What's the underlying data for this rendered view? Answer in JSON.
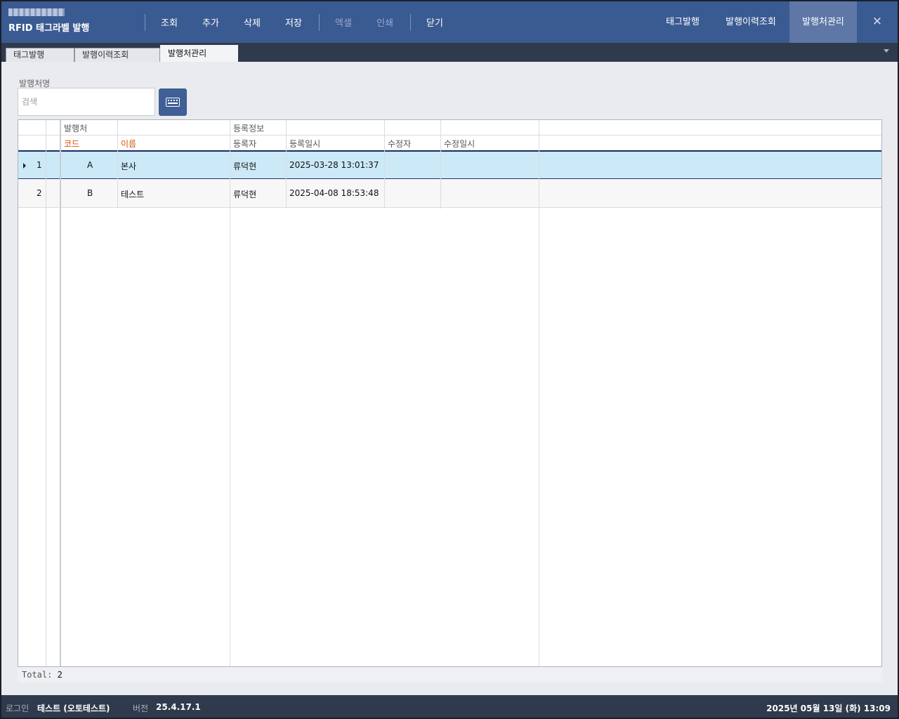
{
  "header": {
    "app_title": "RFID 태그라벨 발행",
    "toolbar": [
      {
        "label": "조회",
        "enabled": true
      },
      {
        "label": "추가",
        "enabled": true
      },
      {
        "label": "삭제",
        "enabled": true
      },
      {
        "label": "저장",
        "enabled": true
      },
      {
        "label": "엑셀",
        "enabled": false
      },
      {
        "label": "인쇄",
        "enabled": false
      },
      {
        "label": "닫기",
        "enabled": true
      }
    ],
    "nav": [
      {
        "label": "태그발행",
        "active": false
      },
      {
        "label": "발행이력조회",
        "active": false
      },
      {
        "label": "발행처관리",
        "active": true
      }
    ],
    "close_glyph": "✕"
  },
  "tabs": [
    {
      "label": "태그발행",
      "active": false
    },
    {
      "label": "발행이력조회",
      "active": false
    },
    {
      "label": "발행처관리",
      "active": true
    }
  ],
  "search": {
    "label": "발행처명",
    "placeholder": "검색",
    "value": "",
    "keyboard_icon": "keyboard-icon"
  },
  "grid": {
    "bands": [
      {
        "label": "발행처"
      },
      {
        "label": "등록정보"
      }
    ],
    "columns": [
      {
        "label": "코드",
        "required": true
      },
      {
        "label": "이름",
        "required": true
      },
      {
        "label": "등록자",
        "required": false
      },
      {
        "label": "등록일시",
        "required": false
      },
      {
        "label": "수정자",
        "required": false
      },
      {
        "label": "수정일시",
        "required": false
      }
    ],
    "rows": [
      {
        "num": "1",
        "code": "A",
        "name": "본사",
        "reg_user": "류덕현",
        "reg_date": "2025-03-28 13:01:37",
        "mod_user": "",
        "mod_date": "",
        "selected": true
      },
      {
        "num": "2",
        "code": "B",
        "name": "테스트",
        "reg_user": "류덕현",
        "reg_date": "2025-04-08 18:53:48",
        "mod_user": "",
        "mod_date": "",
        "selected": false
      }
    ],
    "summary_label": "Total:",
    "summary_value": "2"
  },
  "status": {
    "login_label": "로그인",
    "login_value": "테스트 (오토테스트)",
    "version_label": "버전",
    "version_value": "25.4.17.1",
    "datetime": "2025년 05월 13일 (화) 13:09"
  },
  "colors": {
    "header_bg": "#3a5a92",
    "header_active": "#5e77a6",
    "selected_row": "#cce9f7",
    "required_header": "#d4520b",
    "statusbar_bg": "#2f3a4d"
  }
}
